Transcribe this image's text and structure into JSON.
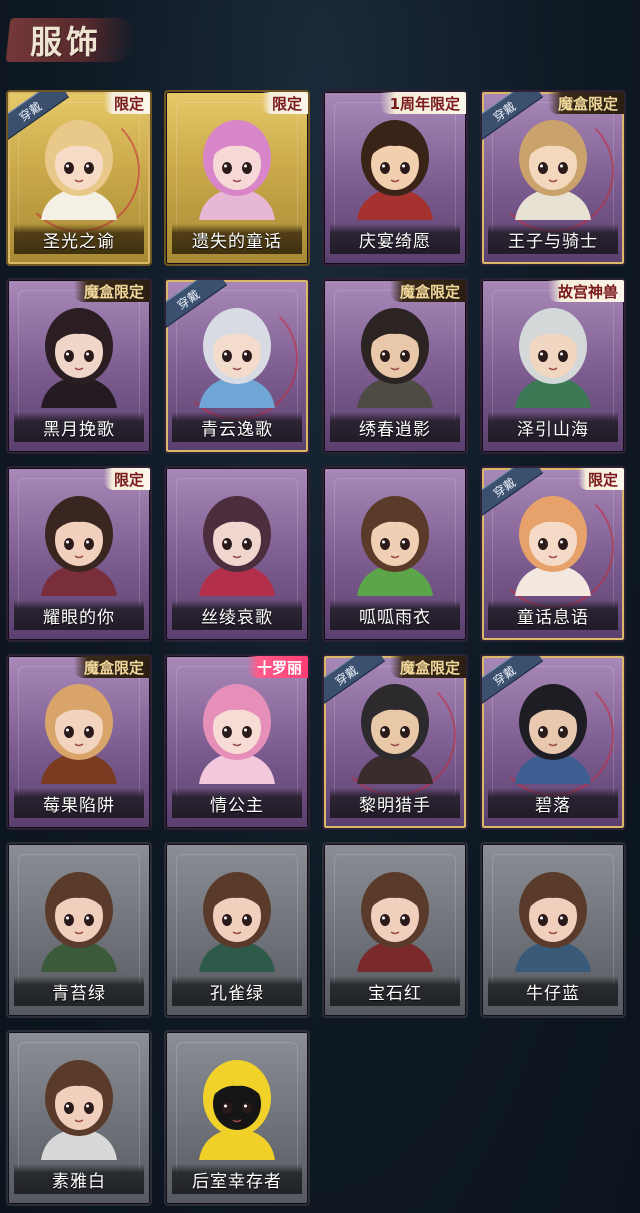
{
  "header": {
    "title": "服饰"
  },
  "tags": {
    "worn": "穿戴"
  },
  "cards": [
    {
      "label": "圣光之谕",
      "tag": "限定",
      "tag_style": "light",
      "worn": true,
      "frame": "gold",
      "hair": "#e9c98a",
      "skin": "#f6dcc6",
      "outfit": "#f4f0e6"
    },
    {
      "label": "遗失的童话",
      "tag": "限定",
      "tag_style": "light",
      "worn": false,
      "frame": "gold",
      "hair": "#d985c9",
      "skin": "#f6d8d6",
      "outfit": "#e7b7d6"
    },
    {
      "label": "庆宴绮愿",
      "tag": "1周年限定",
      "tag_style": "light",
      "worn": false,
      "frame": "purple",
      "hair": "#3a2418",
      "skin": "#f2cfae",
      "outfit": "#a5322f"
    },
    {
      "label": "王子与骑士",
      "tag": "魔盒限定",
      "tag_style": "dark",
      "worn": true,
      "frame": "purple",
      "hair": "#c9a36b",
      "skin": "#f4d8bd",
      "outfit": "#e7e2d3"
    },
    {
      "label": "黑月挽歌",
      "tag": "魔盒限定",
      "tag_style": "dark",
      "worn": false,
      "frame": "purple",
      "hair": "#2a1e22",
      "skin": "#f0d6c8",
      "outfit": "#241a22"
    },
    {
      "label": "青云逸歌",
      "tag": "",
      "tag_style": "",
      "worn": true,
      "frame": "purple",
      "hair": "#d8dbe4",
      "skin": "#f3dccb",
      "outfit": "#6fa6d6"
    },
    {
      "label": "绣春逍影",
      "tag": "魔盒限定",
      "tag_style": "dark",
      "worn": false,
      "frame": "purple",
      "hair": "#2b2422",
      "skin": "#e8c8a8",
      "outfit": "#4e4b45"
    },
    {
      "label": "泽引山海",
      "tag": "故宫神兽",
      "tag_style": "light",
      "worn": false,
      "frame": "purple",
      "hair": "#d4d8d8",
      "skin": "#f1d6c1",
      "outfit": "#3b7a54"
    },
    {
      "label": "耀眼的你",
      "tag": "限定",
      "tag_style": "light",
      "worn": false,
      "frame": "purple",
      "hair": "#3a2620",
      "skin": "#f1d0bd",
      "outfit": "#7a2e3c"
    },
    {
      "label": "丝绫哀歌",
      "tag": "",
      "tag_style": "",
      "worn": false,
      "frame": "purple",
      "hair": "#4a2e3e",
      "skin": "#efd6ce",
      "outfit": "#b4304a"
    },
    {
      "label": "呱呱雨衣",
      "tag": "",
      "tag_style": "",
      "worn": false,
      "frame": "purple",
      "hair": "#5a3a28",
      "skin": "#f0cfb4",
      "outfit": "#5da54a"
    },
    {
      "label": "童话息语",
      "tag": "限定",
      "tag_style": "light",
      "worn": true,
      "frame": "purple",
      "hair": "#e6a26a",
      "skin": "#f6dac8",
      "outfit": "#f2e8e0"
    },
    {
      "label": "莓果陷阱",
      "tag": "魔盒限定",
      "tag_style": "dark",
      "worn": false,
      "frame": "purple",
      "hair": "#d9a46a",
      "skin": "#f1d3be",
      "outfit": "#7a3b20"
    },
    {
      "label": "情公主",
      "tag": "十罗丽",
      "tag_style": "pink",
      "worn": false,
      "frame": "purple",
      "hair": "#e58fb9",
      "skin": "#f7dcd6",
      "outfit": "#f3c7dc"
    },
    {
      "label": "黎明猎手",
      "tag": "魔盒限定",
      "tag_style": "dark",
      "worn": true,
      "frame": "purple",
      "hair": "#2d2a2e",
      "skin": "#e8c8a6",
      "outfit": "#3a2b2c"
    },
    {
      "label": "碧落",
      "tag": "",
      "tag_style": "",
      "worn": true,
      "frame": "purple",
      "hair": "#1e1d24",
      "skin": "#e8c8ae",
      "outfit": "#3e5e92"
    },
    {
      "label": "青苔绿",
      "tag": "",
      "tag_style": "",
      "worn": false,
      "frame": "grey",
      "hair": "#5a3a2a",
      "skin": "#f0d0bd",
      "outfit": "#3a5a3a"
    },
    {
      "label": "孔雀绿",
      "tag": "",
      "tag_style": "",
      "worn": false,
      "frame": "grey",
      "hair": "#5a3a2a",
      "skin": "#f0d0bd",
      "outfit": "#2e5a4a"
    },
    {
      "label": "宝石红",
      "tag": "",
      "tag_style": "",
      "worn": false,
      "frame": "grey",
      "hair": "#5a3a2a",
      "skin": "#f0d0bd",
      "outfit": "#7a2a2a"
    },
    {
      "label": "牛仔蓝",
      "tag": "",
      "tag_style": "",
      "worn": false,
      "frame": "grey",
      "hair": "#5a3a2a",
      "skin": "#f0d0bd",
      "outfit": "#3a5a7a"
    },
    {
      "label": "素雅白",
      "tag": "",
      "tag_style": "",
      "worn": false,
      "frame": "grey",
      "hair": "#5a3a2a",
      "skin": "#f0d0bd",
      "outfit": "#d8d8d8"
    },
    {
      "label": "后室幸存者",
      "tag": "",
      "tag_style": "",
      "worn": false,
      "frame": "grey",
      "hair": "#f1d22a",
      "skin": "#151515",
      "outfit": "#f0cf28"
    }
  ]
}
